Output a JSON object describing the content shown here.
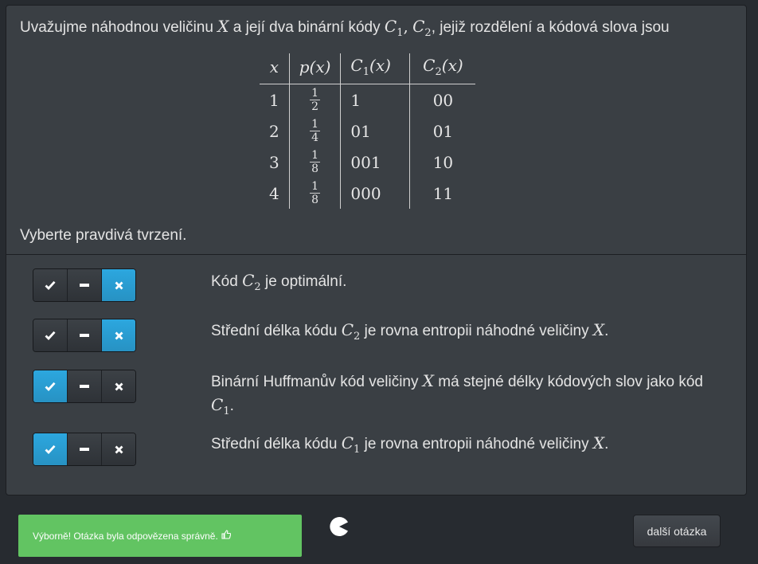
{
  "question": {
    "intro_before": "Uvažujme náhodnou veličinu",
    "var": "X",
    "intro_mid": "a její dva binární kódy",
    "code1": "C",
    "code1_sub": "1",
    "comma": ",",
    "code2": "C",
    "code2_sub": "2",
    "intro_after": ", jejiž rozdělení a kódová slova jsou",
    "prompt": "Vyberte pravdivá tvrzení."
  },
  "table": {
    "headers": {
      "x": "x",
      "p": "p(x)",
      "c1_letter": "C",
      "c1_sub": "1",
      "c1_arg": "(x)",
      "c2_letter": "C",
      "c2_sub": "2",
      "c2_arg": "(x)"
    },
    "rows": [
      {
        "x": "1",
        "p_num": "1",
        "p_den": "2",
        "c1": "1",
        "c2": "00"
      },
      {
        "x": "2",
        "p_num": "1",
        "p_den": "4",
        "c1": "01",
        "c2": "01"
      },
      {
        "x": "3",
        "p_num": "1",
        "p_den": "8",
        "c1": "001",
        "c2": "10"
      },
      {
        "x": "4",
        "p_num": "1",
        "p_den": "8",
        "c1": "000",
        "c2": "11"
      }
    ]
  },
  "statements": [
    {
      "selected": "false",
      "parts": {
        "a": "Kód ",
        "m1": "C",
        "s1": "2",
        "b": " je optimální."
      }
    },
    {
      "selected": "false",
      "parts": {
        "a": "Střední délka kódu ",
        "m1": "C",
        "s1": "2",
        "b": " je rovna entropii náhodné veličiny ",
        "m2": "X",
        "c": "."
      }
    },
    {
      "selected": "true",
      "parts": {
        "a": "Binární Huffmanův kód veličiny ",
        "m1": "X",
        "b": " má stejné délky kódových slov jako kód ",
        "m2": "C",
        "s2": "1",
        "c": "."
      }
    },
    {
      "selected": "true",
      "parts": {
        "a": "Střední délka kódu ",
        "m1": "C",
        "s1": "1",
        "b": " je rovna entropii náhodné veličiny ",
        "m2": "X",
        "c": "."
      }
    }
  ],
  "feedback": {
    "text": "Výborně! Otázka byla odpovězena správně.",
    "icon": "thumbs-up-icon"
  },
  "next_button": "další otázka",
  "colors": {
    "accent": "#2a9fd6",
    "success": "#62c462",
    "panel": "#3a3f44",
    "background": "#272b30"
  }
}
